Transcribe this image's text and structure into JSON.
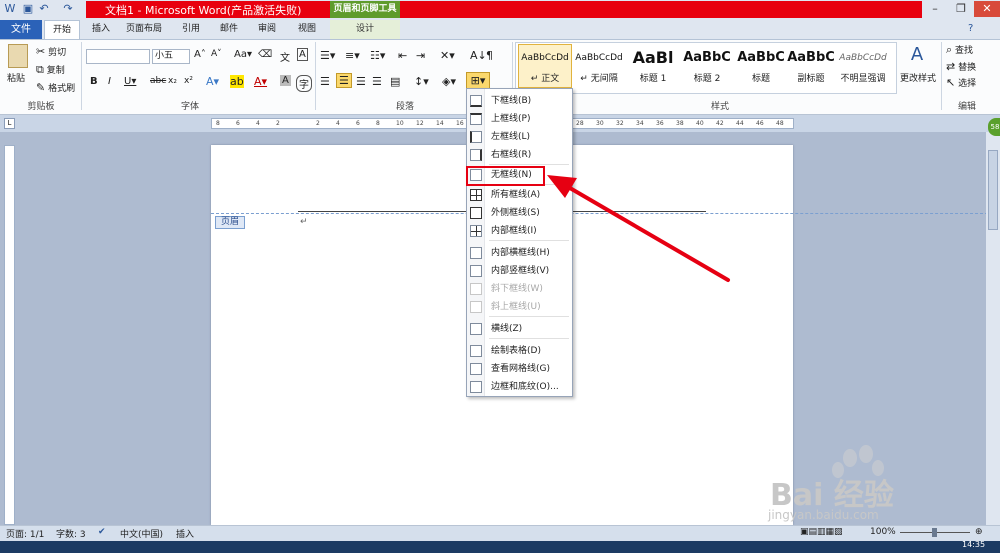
{
  "window": {
    "title": "文档1 - Microsoft Word(产品激活失败)",
    "context_tab_header": "页眉和页脚工具"
  },
  "tabs": {
    "file": "文件",
    "home": "开始",
    "insert": "插入",
    "layout": "页面布局",
    "references": "引用",
    "mailings": "邮件",
    "review": "审阅",
    "view": "视图",
    "design": "设计"
  },
  "clipboard": {
    "paste": "粘贴",
    "cut": "剪切",
    "copy": "复制",
    "format_painter": "格式刷",
    "label": "剪贴板"
  },
  "font": {
    "font_size": "小五",
    "label": "字体"
  },
  "paragraph": {
    "label": "段落"
  },
  "styles": {
    "label": "样式",
    "items": [
      {
        "sample": "AaBbCcDd",
        "name": "↵ 正文"
      },
      {
        "sample": "AaBbCcDd",
        "name": "↵ 无间隔"
      },
      {
        "sample": "AaBl",
        "name": "标题 1"
      },
      {
        "sample": "AaBbC",
        "name": "标题 2"
      },
      {
        "sample": "AaBbC",
        "name": "标题"
      },
      {
        "sample": "AaBbC",
        "name": "副标题"
      },
      {
        "sample": "AaBbCcDd",
        "name": "不明显强调"
      }
    ],
    "change_styles": "更改样式"
  },
  "editing": {
    "find": "查找",
    "replace": "替换",
    "select": "选择",
    "label": "编辑"
  },
  "document": {
    "header_tag": "页眉",
    "paragraph_mark": "↵"
  },
  "border_menu": {
    "items": [
      {
        "label": "下框线(B)",
        "enabled": true
      },
      {
        "label": "上框线(P)",
        "enabled": true
      },
      {
        "label": "左框线(L)",
        "enabled": true
      },
      {
        "label": "右框线(R)",
        "enabled": true
      },
      {
        "label": "无框线(N)",
        "enabled": true
      },
      {
        "label": "所有框线(A)",
        "enabled": true
      },
      {
        "label": "外侧框线(S)",
        "enabled": true
      },
      {
        "label": "内部框线(I)",
        "enabled": true
      },
      {
        "label": "内部横框线(H)",
        "enabled": true
      },
      {
        "label": "内部竖框线(V)",
        "enabled": true
      },
      {
        "label": "斜下框线(W)",
        "enabled": false
      },
      {
        "label": "斜上框线(U)",
        "enabled": false
      },
      {
        "label": "横线(Z)",
        "enabled": true
      },
      {
        "label": "绘制表格(D)",
        "enabled": true
      },
      {
        "label": "查看网格线(G)",
        "enabled": true
      },
      {
        "label": "边框和底纹(O)...",
        "enabled": true
      }
    ]
  },
  "status": {
    "page": "页面: 1/1",
    "words": "字数: 3",
    "language": "中文(中国)",
    "mode": "插入",
    "zoom": "100%",
    "time": "14:35"
  },
  "watermark": {
    "brand": "Bai 经验",
    "url": "jingyan.baidu.com"
  },
  "colors": {
    "title_bar_red": "#e8000e",
    "file_tab_blue": "#2b62b8",
    "context_green": "#5f9b2c",
    "highlight_red": "#e60012"
  }
}
